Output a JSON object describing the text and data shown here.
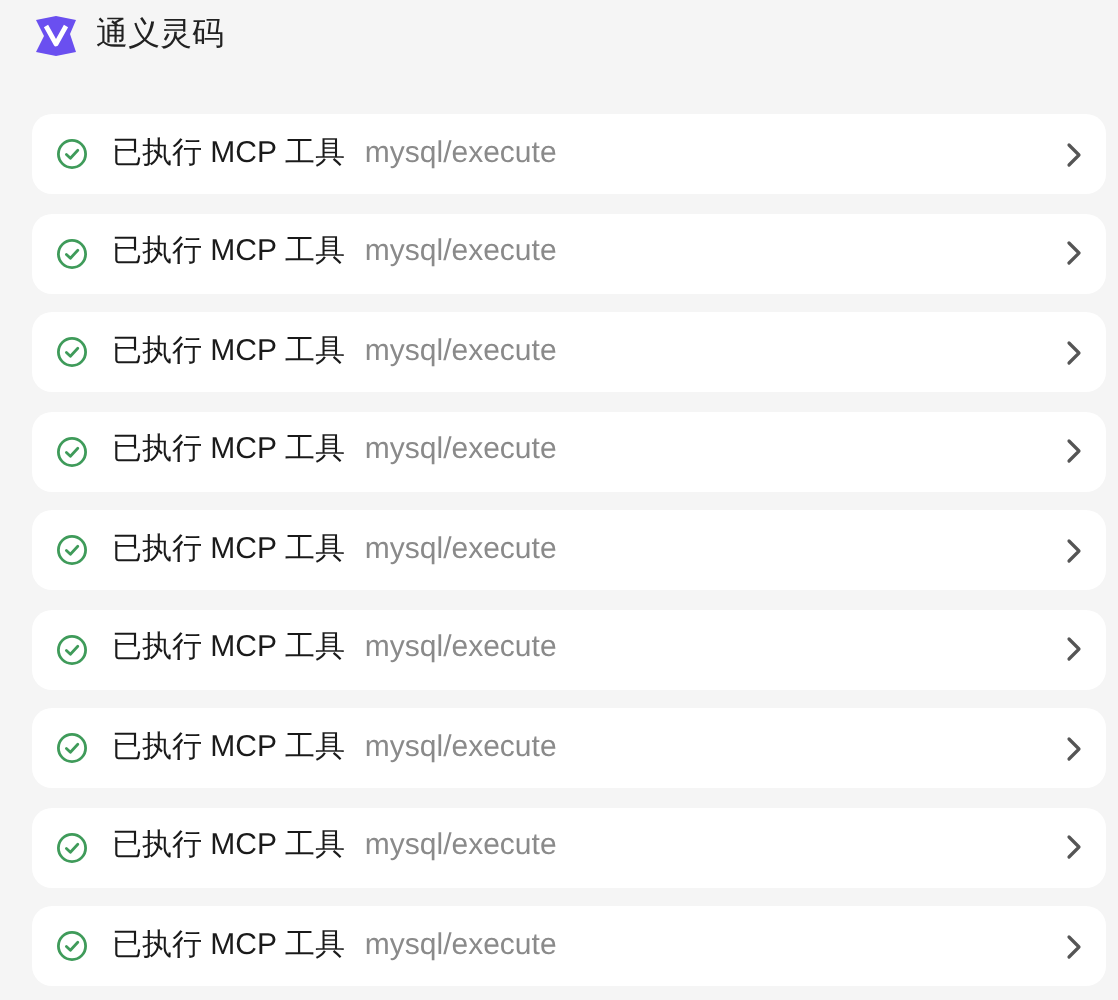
{
  "app": {
    "name": "通义灵码"
  },
  "tool_calls": [
    {
      "succeeded": true,
      "label": "已执行 MCP 工具",
      "tool": "mysql/execute"
    },
    {
      "succeeded": true,
      "label": "已执行 MCP 工具",
      "tool": "mysql/execute"
    },
    {
      "succeeded": true,
      "label": "已执行 MCP 工具",
      "tool": "mysql/execute"
    },
    {
      "succeeded": true,
      "label": "已执行 MCP 工具",
      "tool": "mysql/execute"
    },
    {
      "succeeded": true,
      "label": "已执行 MCP 工具",
      "tool": "mysql/execute"
    },
    {
      "succeeded": true,
      "label": "已执行 MCP 工具",
      "tool": "mysql/execute"
    },
    {
      "succeeded": true,
      "label": "已执行 MCP 工具",
      "tool": "mysql/execute"
    },
    {
      "succeeded": true,
      "label": "已执行 MCP 工具",
      "tool": "mysql/execute"
    },
    {
      "succeeded": true,
      "label": "已执行 MCP 工具",
      "tool": "mysql/execute"
    }
  ]
}
